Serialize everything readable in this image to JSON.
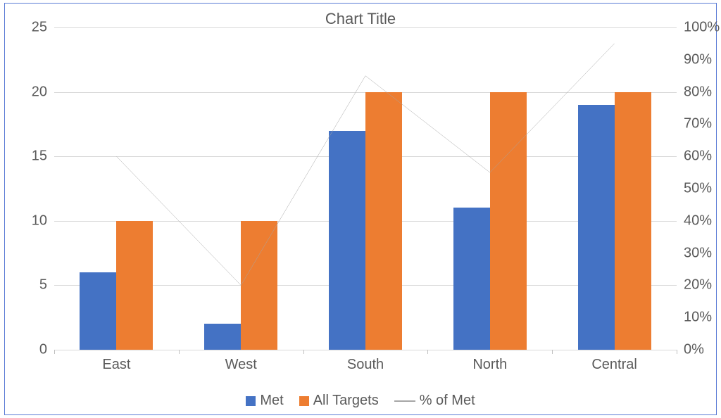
{
  "chart_data": {
    "type": "bar",
    "title": "Chart Title",
    "categories": [
      "East",
      "West",
      "South",
      "North",
      "Central"
    ],
    "series": [
      {
        "name": "Met",
        "type": "bar",
        "axis": "left",
        "values": [
          6,
          2,
          17,
          11,
          19
        ],
        "color": "#4472c4"
      },
      {
        "name": "All Targets",
        "type": "bar",
        "axis": "left",
        "values": [
          10,
          10,
          20,
          20,
          20
        ],
        "color": "#ed7d31"
      },
      {
        "name": "% of Met",
        "type": "line",
        "axis": "right",
        "values": [
          60,
          20,
          85,
          55,
          95
        ],
        "color": "#a6a6a6"
      }
    ],
    "y_left": {
      "min": 0,
      "max": 25,
      "ticks": [
        0,
        5,
        10,
        15,
        20,
        25
      ]
    },
    "y_right": {
      "min": 0,
      "max": 100,
      "ticks": [
        0,
        10,
        20,
        30,
        40,
        50,
        60,
        70,
        80,
        90,
        100
      ],
      "suffix": "%"
    },
    "legend_position": "bottom",
    "grid": true
  },
  "legend": {
    "items": [
      {
        "label": "Met"
      },
      {
        "label": "All Targets"
      },
      {
        "label": "% of Met"
      }
    ]
  }
}
